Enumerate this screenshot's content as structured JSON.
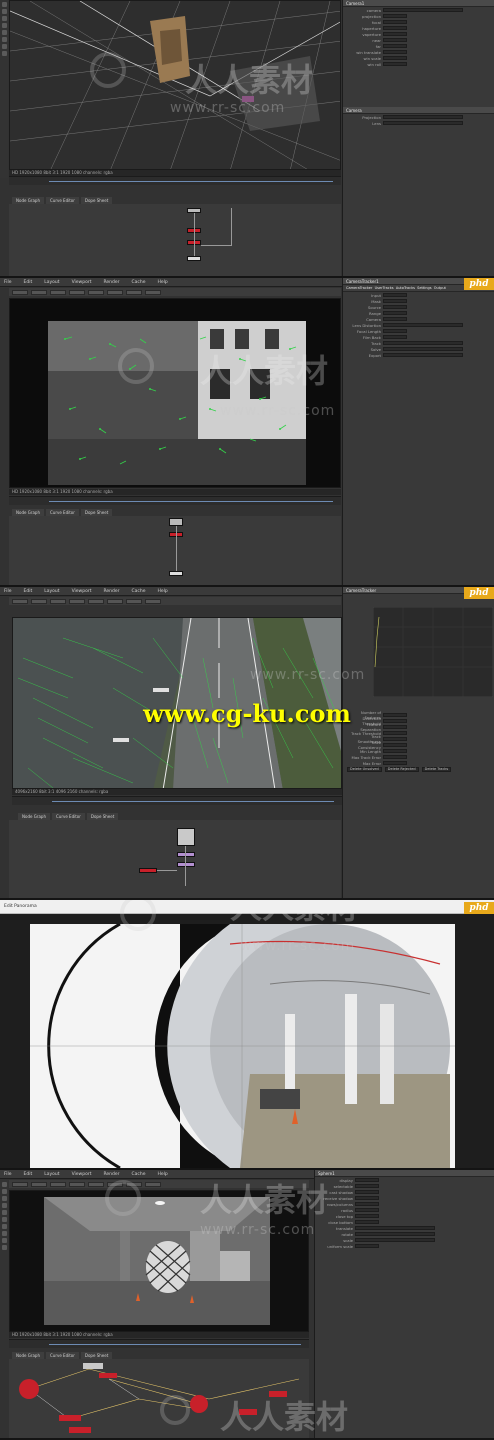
{
  "menu": [
    "File",
    "Edit",
    "Layout",
    "Viewport",
    "Render",
    "Cache",
    "Help"
  ],
  "viewer_tabs": [
    "Node Graph",
    "Curve Editor",
    "Dope Sheet"
  ],
  "panels": [
    {
      "id": "p1",
      "status": "HD 1920x1080 8bit  3:1 1920 1080 channels: rgba",
      "props_title": "Camera1",
      "props_rows": [
        "camera",
        "projection",
        "focal",
        "haperture",
        "vaperture",
        "near",
        "far",
        "win translate",
        "win scale",
        "win roll"
      ],
      "props_tabs": [
        "Camera",
        "Projection",
        "Lens"
      ]
    },
    {
      "id": "p2",
      "status": "HD 1920x1080 8bit  3:1 1920 1080 channels: rgba",
      "props_title": "CameraTracker1",
      "props_rows": [
        "Input",
        "Mask",
        "Source",
        "Range",
        "Camera",
        "Lens Distortion",
        "Focal Length",
        "Film Back",
        "Track",
        "Solve",
        "Export"
      ],
      "props_tabs": [
        "CameraTracker",
        "UserTracks",
        "AutoTracks",
        "Settings",
        "Output"
      ]
    },
    {
      "id": "p3",
      "status": "4096x2160 8bit  3:1 4096 2160 channels: rgba",
      "props_title": "CameraTracker",
      "props_rows": [
        "Number of Features",
        "Detection Threshold",
        "Feature Separation",
        "Track Threshold",
        "Track Smoothness",
        "Track Consistency",
        "Min Length",
        "Max Track Error",
        "Max Error"
      ],
      "props_buttons": [
        "Delete Unsolved",
        "Delete Rejected",
        "Delete Tracks"
      ]
    },
    {
      "id": "p4",
      "title": "Edit Panorama"
    },
    {
      "id": "p5",
      "status": "HD 1920x1080 8bit  3:1 1920 1080 channels: rgba",
      "props_title": "Sphere1",
      "props_rows": [
        "display",
        "selectable",
        "cast shadow",
        "receive shadow",
        "rows/columns",
        "radius",
        "close top",
        "close bottom",
        "translate",
        "rotate",
        "scale",
        "uniform scale"
      ]
    }
  ],
  "watermark": {
    "cn": "人人素材",
    "url": "www.rr-sc.com",
    "phd": "phd",
    "cgku": "www.cg-ku.com"
  },
  "colors": {
    "panel_bg": "#323232",
    "viewer_bg": "#111111",
    "node_red": "#c8202a",
    "track_green": "#34d24a",
    "phd_orange": "#e8a91b",
    "cgku_yellow": "#ffff00"
  }
}
